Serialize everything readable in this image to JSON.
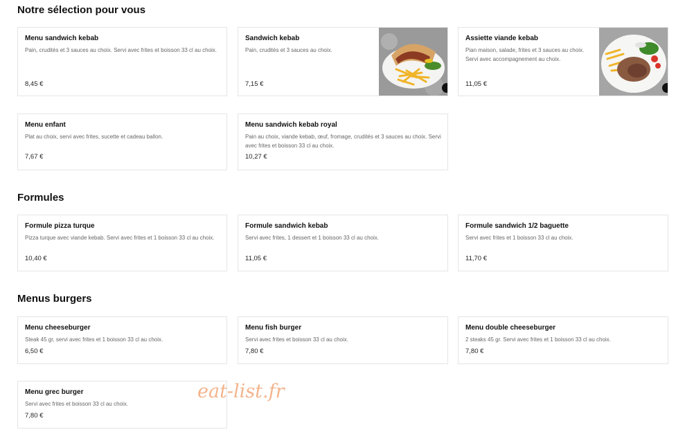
{
  "sections": [
    {
      "title": "Notre sélection pour vous",
      "items": [
        {
          "name": "Menu sandwich kebab",
          "desc": "Pain, crudités et 3 sauces au choix. Servi avec frites et boisson 33 cl au choix.",
          "price": "8,45 €"
        },
        {
          "name": "Sandwich kebab",
          "desc": "Pain, crudités et 3 sauces au choix.",
          "price": "7,15 €",
          "image": "kebab-sandwich-photo"
        },
        {
          "name": "Assiette viande kebab",
          "desc": "Pian maison, salade, frites et 3 sauces au choix. Servi avec accompagnement au choix.",
          "price": "11,05 €",
          "image": "kebab-plate-photo"
        },
        {
          "name": "Menu enfant",
          "desc": "Plat au choix, servi avec frites, sucette et cadeau ballon.",
          "price": "7,67 €"
        },
        {
          "name": "Menu sandwich kebab royal",
          "desc": "Pain au choix, viande kebab, œuf, fromage, crudités et 3 sauces au choix. Servi avec frites et boisson 33 cl au choix.",
          "price": "10,27 €"
        }
      ]
    },
    {
      "title": "Formules",
      "items": [
        {
          "name": "Formule pizza turque",
          "desc": "Pizza turque avec viande kebab. Servi avec frites et 1 boisson 33 cl au choix.",
          "price": "10,40 €"
        },
        {
          "name": "Formule sandwich kebab",
          "desc": "Servi avec frites, 1 dessert et 1 boisson 33 cl au choix.",
          "price": "11,05 €"
        },
        {
          "name": "Formule sandwich 1/2 baguette",
          "desc": "Servi avec frites et 1 boisson 33 cl au choix.",
          "price": "11,70 €"
        }
      ]
    },
    {
      "title": "Menus burgers",
      "items": [
        {
          "name": "Menu cheeseburger",
          "desc": "Steak 45 gr, servi avec frites et 1 boisson 33 cl au choix.",
          "price": "6,50 €"
        },
        {
          "name": "Menu fish burger",
          "desc": "Servi avec frites et boisson 33 cl au choix.",
          "price": "7,80 €"
        },
        {
          "name": "Menu double cheeseburger",
          "desc": "2 steaks 45 gr. Servi avec frites et 1 boisson 33 cl au choix.",
          "price": "7,80 €"
        },
        {
          "name": "Menu grec burger",
          "desc": "Servi avec frites et boisson 33 cl au choix.",
          "price": "7,80 €"
        }
      ]
    }
  ],
  "watermark": "eat-list.fr"
}
